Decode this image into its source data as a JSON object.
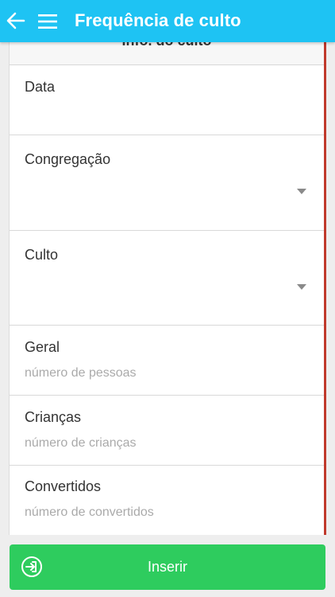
{
  "app_bar": {
    "title": "Frequência de culto",
    "back_icon": "arrow-left-icon",
    "menu_icon": "hamburger-menu-icon",
    "background": "#1ec3f3"
  },
  "section": {
    "title": "Info. do culto"
  },
  "fields": {
    "data": {
      "label": "Data",
      "value": ""
    },
    "congregacao": {
      "label": "Congregação",
      "selected": ""
    },
    "culto": {
      "label": "Culto",
      "selected": ""
    },
    "geral": {
      "label": "Geral",
      "placeholder": "número de pessoas"
    },
    "criancas": {
      "label": "Crianças",
      "placeholder": "número de crianças"
    },
    "convertidos": {
      "label": "Convertidos",
      "placeholder": "número de convertidos"
    }
  },
  "submit": {
    "label": "Inserir",
    "icon": "sign-in-icon",
    "color": "#2ecc5e"
  },
  "colors": {
    "validation_border": "#c0392b"
  }
}
